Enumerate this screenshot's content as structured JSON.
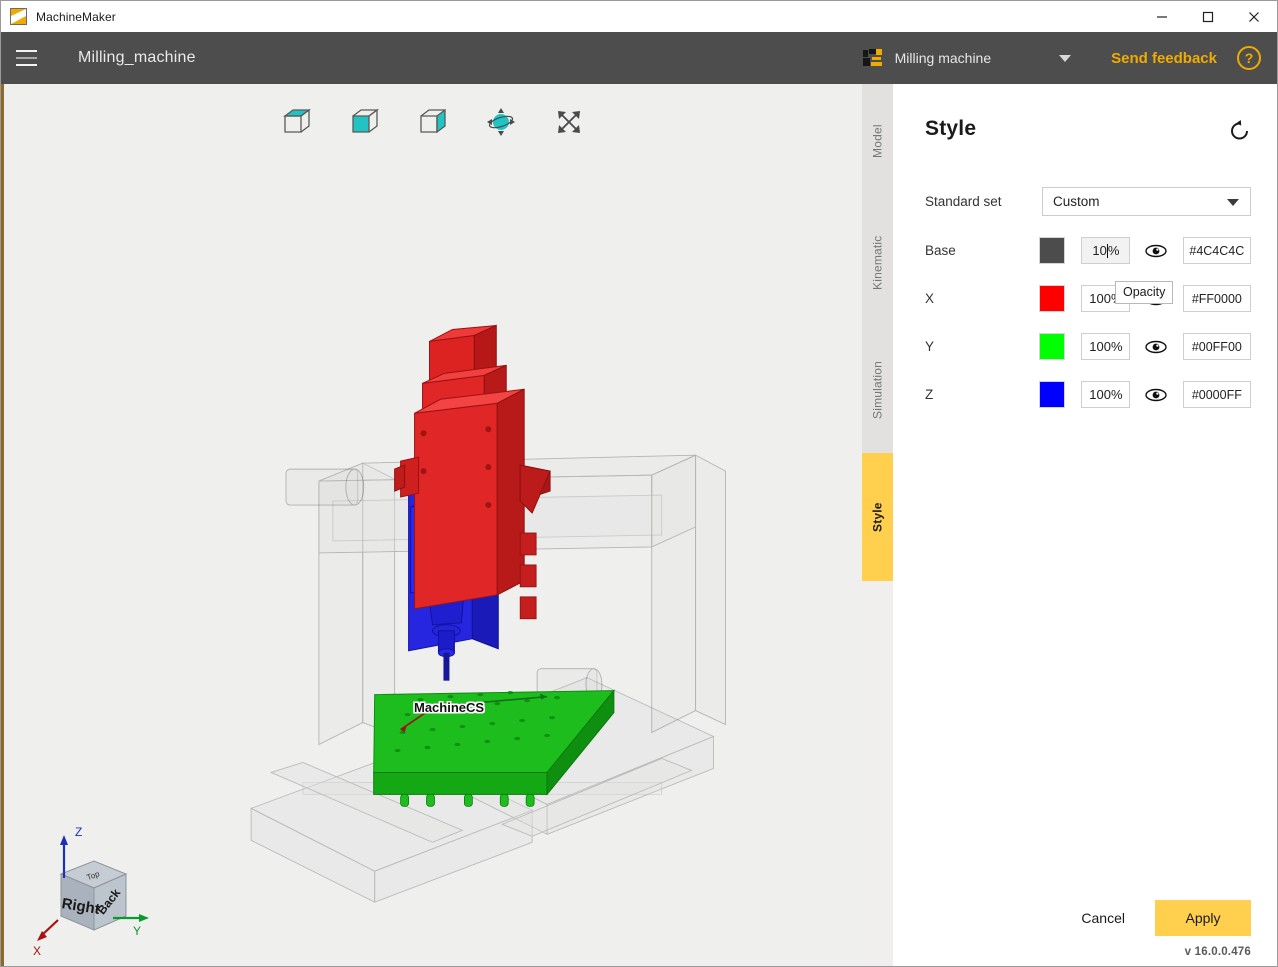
{
  "window": {
    "app_title": "MachineMaker",
    "app_logo_icon": "machinemaker-logo-icon",
    "minimize_icon": "minimize-icon",
    "maximize_icon": "maximize-icon",
    "close_icon": "close-icon"
  },
  "header": {
    "menu_icon": "hamburger-menu-icon",
    "document_title": "Milling_machine",
    "machine_icon": "machine-component-icon",
    "machine_selector_value": "Milling machine",
    "dropdown_caret_icon": "chevron-down-icon",
    "feedback_label": "Send feedback",
    "help_label": "?",
    "accent_color": "#f0ab00"
  },
  "viewport": {
    "toolbar": [
      {
        "name": "view-top-button",
        "icon": "cube-top-face-icon"
      },
      {
        "name": "view-front-button",
        "icon": "cube-front-face-icon"
      },
      {
        "name": "view-right-button",
        "icon": "cube-right-face-icon"
      },
      {
        "name": "orbit-rotate-button",
        "icon": "orbit-sphere-icon"
      },
      {
        "name": "fit-to-screen-button",
        "icon": "expand-arrows-icon"
      }
    ],
    "scene_label": "MachineCS",
    "background_color": "#efefee",
    "navcube": {
      "face_left": "Right",
      "face_right": "Back",
      "face_top": "Top",
      "axis_x": "X",
      "axis_y": "Y",
      "axis_z": "Z",
      "axis_x_color": "#aa1111",
      "axis_y_color": "#0a9c2a",
      "axis_z_color": "#1b2fbb"
    }
  },
  "tabs": [
    {
      "label": "Model",
      "active": false
    },
    {
      "label": "Kinematic",
      "active": false
    },
    {
      "label": "Simulation",
      "active": false
    },
    {
      "label": "Style",
      "active": true
    }
  ],
  "panel": {
    "title": "Style",
    "reset_icon": "reset-rotate-icon",
    "standard_set": {
      "label": "Standard set",
      "value": "Custom"
    },
    "rows": [
      {
        "label": "Base",
        "color": "#4C4C4C",
        "opacity": "10",
        "opacity_suffix": "%",
        "hex": "#4C4C4C",
        "eye_icon": "eye-visible-icon",
        "focused": true
      },
      {
        "label": "X",
        "color": "#FF0000",
        "opacity": "100",
        "opacity_suffix": "%",
        "hex": "#FF0000",
        "eye_icon": "eye-visible-icon",
        "focused": false
      },
      {
        "label": "Y",
        "color": "#00FF00",
        "opacity": "100",
        "opacity_suffix": "%",
        "hex": "#00FF00",
        "eye_icon": "eye-visible-icon",
        "focused": false
      },
      {
        "label": "Z",
        "color": "#0000FF",
        "opacity": "100",
        "opacity_suffix": "%",
        "hex": "#0000FF",
        "eye_icon": "eye-visible-icon",
        "focused": false
      }
    ],
    "tooltip": "Opacity",
    "cancel_label": "Cancel",
    "apply_label": "Apply",
    "version": "v 16.0.0.476",
    "apply_color": "#ffcf4d"
  }
}
